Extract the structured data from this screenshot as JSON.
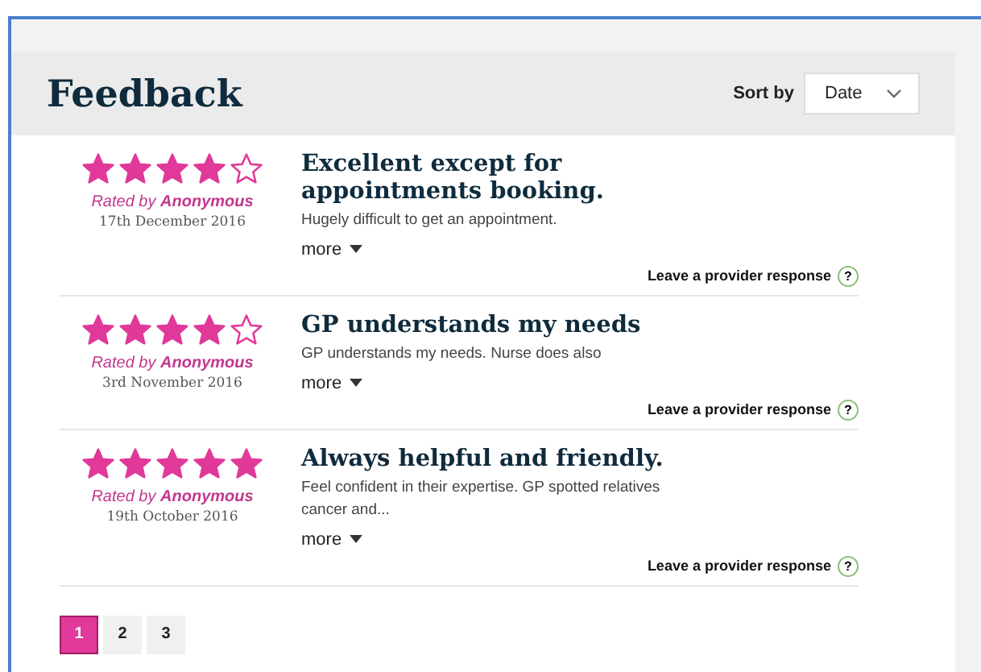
{
  "title": "Feedback",
  "sort": {
    "label": "Sort by",
    "value": "Date"
  },
  "reviews": [
    {
      "stars": 4,
      "rated_by": "Rated by **Anonymous**",
      "date": "17th December 2016",
      "title": "Excellent except for appointments booking.",
      "body": "Hugely difficult to get an appointment.",
      "more": "more",
      "response": "Leave a provider response",
      "help": "?"
    },
    {
      "stars": 4,
      "rated_by": "Rated by **Anonymous**",
      "date": "3rd November 2016",
      "title": "GP understands my needs",
      "body": "GP understands my needs. Nurse does also",
      "more": "more",
      "response": "Leave a provider response",
      "help": "?"
    },
    {
      "stars": 5,
      "rated_by": "Rated by **Anonymous**",
      "date": "19th October 2016",
      "title": "Always helpful and friendly.",
      "body": "Feel confident in their expertise. GP spotted relatives cancer and...",
      "more": "more",
      "response": "Leave a provider response",
      "help": "?"
    }
  ],
  "pages": [
    {
      "label": "1",
      "selected": true
    },
    {
      "label": "2",
      "selected": false
    },
    {
      "label": "3",
      "selected": false
    }
  ]
}
